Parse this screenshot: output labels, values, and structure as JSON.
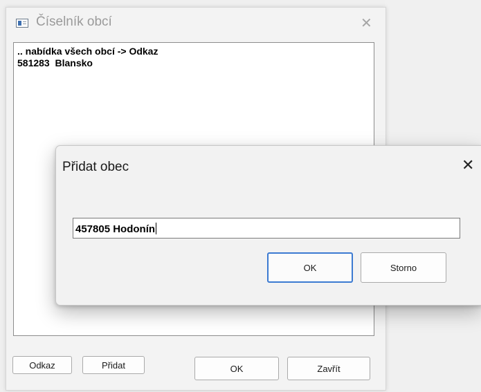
{
  "back_window": {
    "title": "Číselník obcí",
    "close_glyph": "✕",
    "list_items": [
      ".. nabídka všech obcí -> Odkaz",
      "581283  Blansko"
    ],
    "buttons": {
      "odkaz": "Odkaz",
      "pridat": "Přidat",
      "ok": "OK",
      "zavrit": "Zavřít"
    }
  },
  "dialog": {
    "title": "Přidat obec",
    "close_glyph": "✕",
    "input_value": "457805 Hodonín",
    "ok_label": "OK",
    "cancel_label": "Storno"
  },
  "colors": {
    "default_button_border": "#3b7ad1",
    "window_background": "#f3f3f3"
  }
}
